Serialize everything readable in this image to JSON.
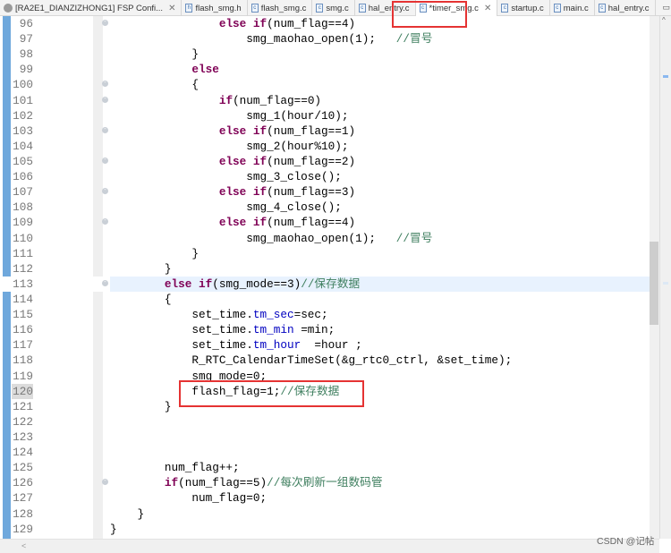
{
  "tabs": [
    {
      "label": "[RA2E1_DIANZIZHONG1] FSP Confi...",
      "icon": "gear-icon",
      "close": "✕"
    },
    {
      "label": "flash_smg.h",
      "icon": "h-file-icon"
    },
    {
      "label": "flash_smg.c",
      "icon": "c-file-icon"
    },
    {
      "label": "smg.c",
      "icon": "c-file-icon"
    },
    {
      "label": "hal_entry.c",
      "icon": "c-file-icon"
    },
    {
      "label": "*timer_smg.c",
      "icon": "c-file-icon",
      "close": "✕",
      "active": true
    },
    {
      "label": "startup.c",
      "icon": "c-file-icon"
    },
    {
      "label": "main.c",
      "icon": "c-file-icon"
    },
    {
      "label": "hal_entry.c",
      "icon": "c-file-icon"
    }
  ],
  "window_controls": {
    "minimize": "▭",
    "maximize": "▢"
  },
  "colors": {
    "keyword": "#7f0055",
    "field": "#0000c0",
    "comment": "#3f7f5f",
    "highlight": "#e8f2fe",
    "annotation": "#e53333"
  },
  "current_line": 113,
  "selected_line_number": 120,
  "lines": [
    {
      "n": "96",
      "fold": true,
      "t": [
        [
          "p",
          "                "
        ],
        [
          "k",
          "else if"
        ],
        [
          "p",
          "(num_flag==4)"
        ]
      ]
    },
    {
      "n": "97",
      "t": [
        [
          "p",
          "                    smg_maohao_open(1);   "
        ],
        [
          "c",
          "//冒号"
        ]
      ]
    },
    {
      "n": "98",
      "t": [
        [
          "p",
          "            }"
        ]
      ]
    },
    {
      "n": "99",
      "t": [
        [
          "p",
          "            "
        ],
        [
          "k",
          "else"
        ]
      ]
    },
    {
      "n": "100",
      "fold": true,
      "t": [
        [
          "p",
          "            {"
        ]
      ]
    },
    {
      "n": "101",
      "fold": true,
      "t": [
        [
          "p",
          "                "
        ],
        [
          "k",
          "if"
        ],
        [
          "p",
          "(num_flag==0)"
        ]
      ]
    },
    {
      "n": "102",
      "t": [
        [
          "p",
          "                    smg_1(hour/10);"
        ]
      ]
    },
    {
      "n": "103",
      "fold": true,
      "t": [
        [
          "p",
          "                "
        ],
        [
          "k",
          "else if"
        ],
        [
          "p",
          "(num_flag==1)"
        ]
      ]
    },
    {
      "n": "104",
      "t": [
        [
          "p",
          "                    smg_2(hour%10);"
        ]
      ]
    },
    {
      "n": "105",
      "fold": true,
      "t": [
        [
          "p",
          "                "
        ],
        [
          "k",
          "else if"
        ],
        [
          "p",
          "(num_flag==2)"
        ]
      ]
    },
    {
      "n": "106",
      "t": [
        [
          "p",
          "                    smg_3_close();"
        ]
      ]
    },
    {
      "n": "107",
      "fold": true,
      "t": [
        [
          "p",
          "                "
        ],
        [
          "k",
          "else if"
        ],
        [
          "p",
          "(num_flag==3)"
        ]
      ]
    },
    {
      "n": "108",
      "t": [
        [
          "p",
          "                    smg_4_close();"
        ]
      ]
    },
    {
      "n": "109",
      "fold": true,
      "t": [
        [
          "p",
          "                "
        ],
        [
          "k",
          "else if"
        ],
        [
          "p",
          "(num_flag==4)"
        ]
      ]
    },
    {
      "n": "110",
      "t": [
        [
          "p",
          "                    smg_maohao_open(1);   "
        ],
        [
          "c",
          "//冒号"
        ]
      ]
    },
    {
      "n": "111",
      "t": [
        [
          "p",
          "            }"
        ]
      ]
    },
    {
      "n": "112",
      "t": [
        [
          "p",
          "        }"
        ]
      ]
    },
    {
      "n": "113",
      "fold": true,
      "t": [
        [
          "p",
          "        "
        ],
        [
          "k",
          "else if"
        ],
        [
          "p",
          "(smg_mode==3)"
        ],
        [
          "c",
          "//保存数据"
        ]
      ]
    },
    {
      "n": "114",
      "t": [
        [
          "p",
          "        {"
        ]
      ]
    },
    {
      "n": "115",
      "t": [
        [
          "p",
          "            set_time."
        ],
        [
          "f",
          "tm_sec"
        ],
        [
          "p",
          "=sec;"
        ]
      ]
    },
    {
      "n": "116",
      "t": [
        [
          "p",
          "            set_time."
        ],
        [
          "f",
          "tm_min"
        ],
        [
          "p",
          " =min;"
        ]
      ]
    },
    {
      "n": "117",
      "t": [
        [
          "p",
          "            set_time."
        ],
        [
          "f",
          "tm_hour"
        ],
        [
          "p",
          "  =hour ;"
        ]
      ]
    },
    {
      "n": "118",
      "t": [
        [
          "p",
          "            R_RTC_CalendarTimeSet(&g_rtc0_ctrl, &set_time);"
        ]
      ]
    },
    {
      "n": "119",
      "t": [
        [
          "p",
          "            smg_mode=0;"
        ]
      ]
    },
    {
      "n": "120",
      "t": [
        [
          "p",
          "            flash_flag=1;"
        ],
        [
          "c",
          "//保存数据"
        ]
      ]
    },
    {
      "n": "121",
      "t": [
        [
          "p",
          "        }"
        ]
      ]
    },
    {
      "n": "122",
      "t": []
    },
    {
      "n": "123",
      "t": []
    },
    {
      "n": "124",
      "t": []
    },
    {
      "n": "125",
      "t": [
        [
          "p",
          "        num_flag++;"
        ]
      ]
    },
    {
      "n": "126",
      "fold": true,
      "t": [
        [
          "p",
          "        "
        ],
        [
          "k",
          "if"
        ],
        [
          "p",
          "(num_flag==5)"
        ],
        [
          "c",
          "//每次刷新一组数码管"
        ]
      ]
    },
    {
      "n": "127",
      "t": [
        [
          "p",
          "            num_flag=0;"
        ]
      ]
    },
    {
      "n": "128",
      "t": [
        [
          "p",
          "    }"
        ]
      ]
    },
    {
      "n": "129",
      "t": [
        [
          "p",
          "}"
        ]
      ]
    }
  ],
  "hscroll_arrow": "<",
  "scroll_up": "^",
  "watermark": "CSDN @记帖"
}
